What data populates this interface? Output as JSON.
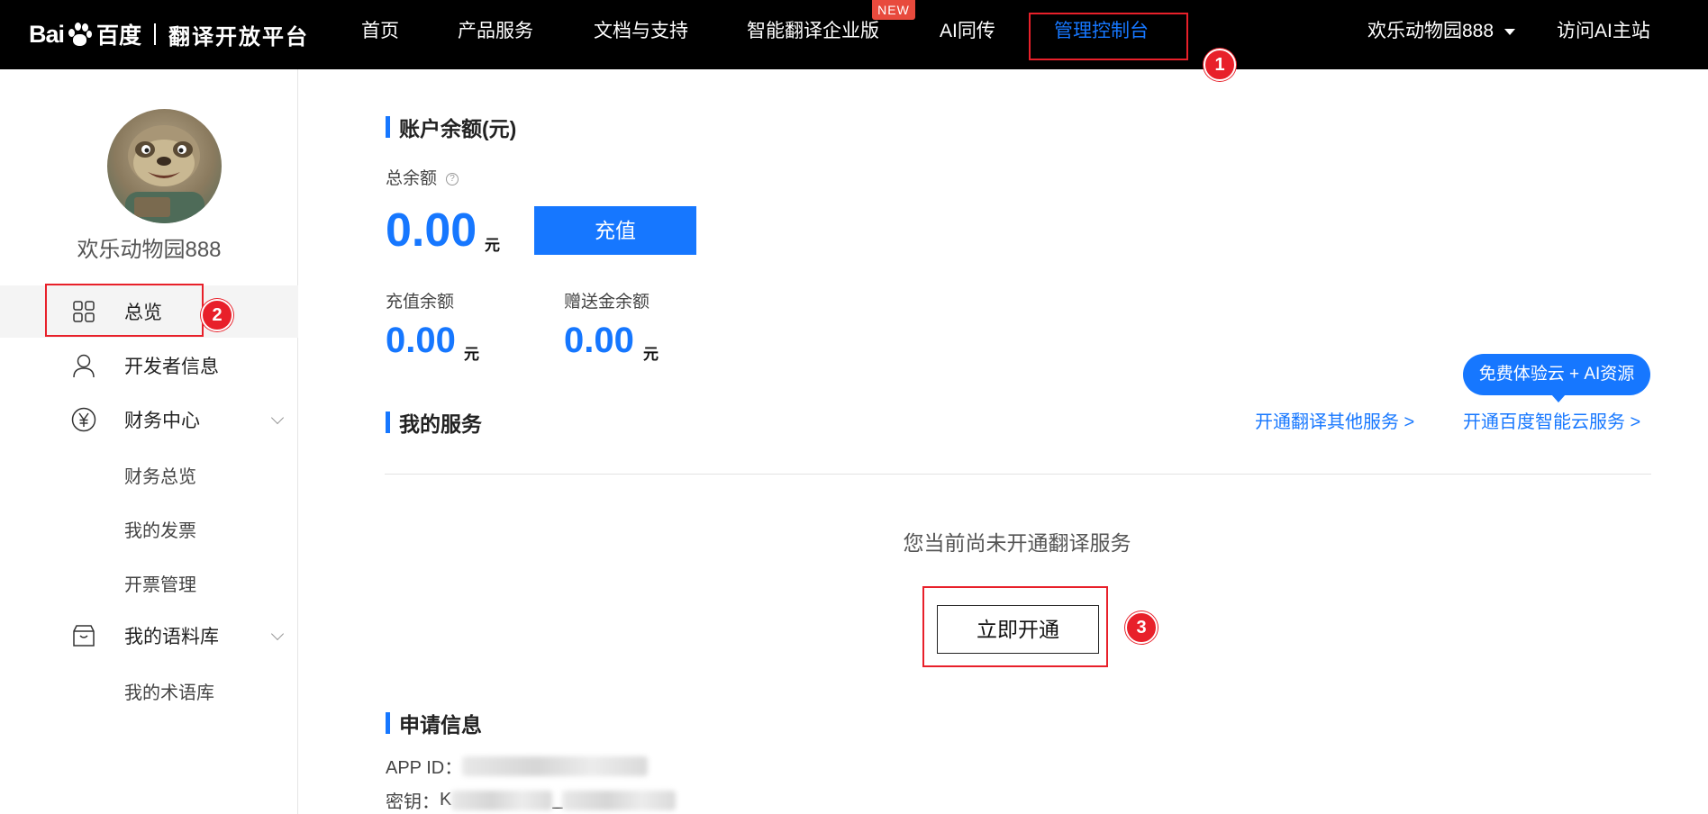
{
  "header": {
    "logo": {
      "bai": "Bai",
      "cn": "百度",
      "subtitle": "翻译开放平台"
    },
    "nav": [
      {
        "label": "首页"
      },
      {
        "label": "产品服务"
      },
      {
        "label": "文档与支持"
      },
      {
        "label": "智能翻译企业版",
        "badge": "NEW"
      },
      {
        "label": "AI同传"
      },
      {
        "label": "管理控制台",
        "active": true
      }
    ],
    "user_name": "欢乐动物园888",
    "visit_ai": "访问AI主站"
  },
  "annotations": {
    "m1": "1",
    "m2": "2",
    "m3": "3"
  },
  "sidebar": {
    "username": "欢乐动物园888",
    "items": [
      {
        "label": "总览",
        "icon": "grid-icon",
        "active": true
      },
      {
        "label": "开发者信息",
        "icon": "user-icon"
      },
      {
        "label": "财务中心",
        "icon": "yuan-icon"
      },
      {
        "label": "财务总览"
      },
      {
        "label": "我的发票"
      },
      {
        "label": "开票管理"
      },
      {
        "label": "我的语料库",
        "icon": "box-icon"
      },
      {
        "label": "我的术语库"
      }
    ]
  },
  "balance": {
    "title": "账户余额(元)",
    "total_label": "总余额",
    "help": "?",
    "total_value": "0.00",
    "unit": "元",
    "recharge_label": "充值",
    "recharge_balance_label": "充值余额",
    "recharge_balance_value": "0.00",
    "gift_balance_label": "赠送金余额",
    "gift_balance_value": "0.00"
  },
  "services": {
    "title": "我的服务",
    "link_other": "开通翻译其他服务 >",
    "link_cloud": "开通百度智能云服务 >",
    "promo": "免费体验云 + AI资源",
    "empty_text": "您当前尚未开通翻译服务",
    "open_label": "立即开通"
  },
  "application": {
    "title": "申请信息",
    "app_id_label": "APP ID：",
    "secret_label": "密钥：",
    "secret_prefix": "K",
    "secret_mid": "_"
  },
  "colors": {
    "accent": "#1677ff",
    "annotation": "#e8202a",
    "badge": "#e84a3d"
  }
}
